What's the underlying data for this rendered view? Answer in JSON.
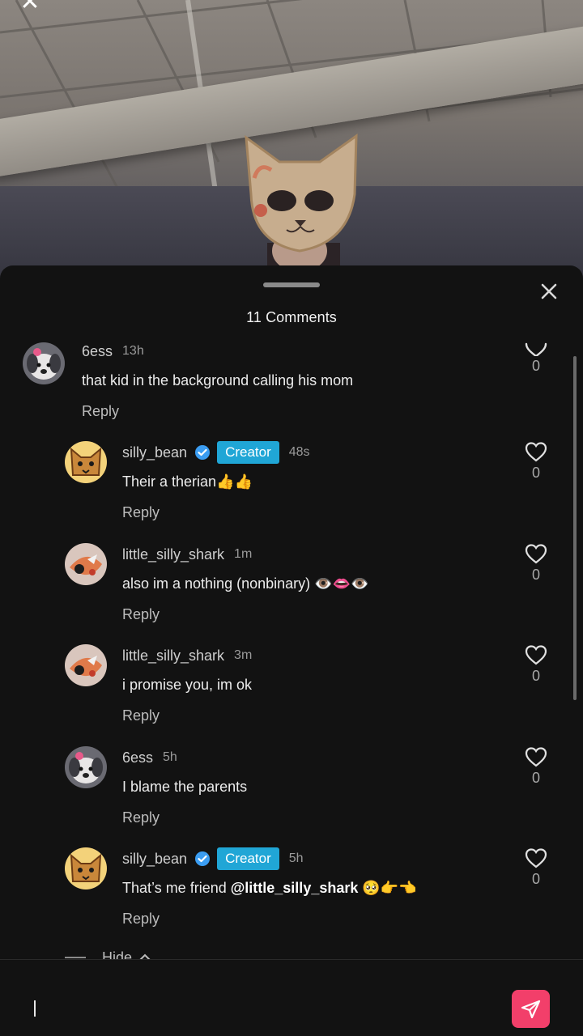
{
  "sheet": {
    "title": "11 Comments"
  },
  "comments": [
    {
      "user": "6ess",
      "time": "13h",
      "text": "that kid in the background calling his mom",
      "reply": "Reply",
      "likes": "0",
      "creator": false,
      "verified": false,
      "avatar": "dog-avatar"
    },
    {
      "user": "silly_bean",
      "badge": "Creator",
      "time": "48s",
      "text": "Their a therian👍👍",
      "reply": "Reply",
      "likes": "0",
      "creator": true,
      "verified": true,
      "avatar": "fox-avatar"
    },
    {
      "user": "little_silly_shark",
      "time": "1m",
      "text": "also im a nothing (nonbinary) 👁️👄👁️",
      "reply": "Reply",
      "likes": "0",
      "creator": false,
      "verified": false,
      "avatar": "shark-avatar"
    },
    {
      "user": "little_silly_shark",
      "time": "3m",
      "text": "i promise you, im ok",
      "reply": "Reply",
      "likes": "0",
      "creator": false,
      "verified": false,
      "avatar": "shark-avatar"
    },
    {
      "user": "6ess",
      "time": "5h",
      "text": "I blame the parents",
      "reply": "Reply",
      "likes": "0",
      "creator": false,
      "verified": false,
      "avatar": "dog-avatar"
    },
    {
      "user": "silly_bean",
      "badge": "Creator",
      "time": "5h",
      "text_prefix": "That’s me friend ",
      "mention": "@little_silly_shark",
      "text_suffix": " 🥺👉👈",
      "reply": "Reply",
      "likes": "0",
      "creator": true,
      "verified": true,
      "avatar": "fox-avatar"
    }
  ],
  "hide": {
    "label": "Hide"
  },
  "colors": {
    "accent_send": "#f23f6a",
    "creator_badge": "#20a6d6",
    "sheet_bg": "#121212"
  },
  "icons": {
    "close": "close-icon",
    "heart": "heart-icon",
    "send": "send-icon",
    "verified": "verified-badge-icon",
    "chevron": "chevron-up-icon"
  }
}
